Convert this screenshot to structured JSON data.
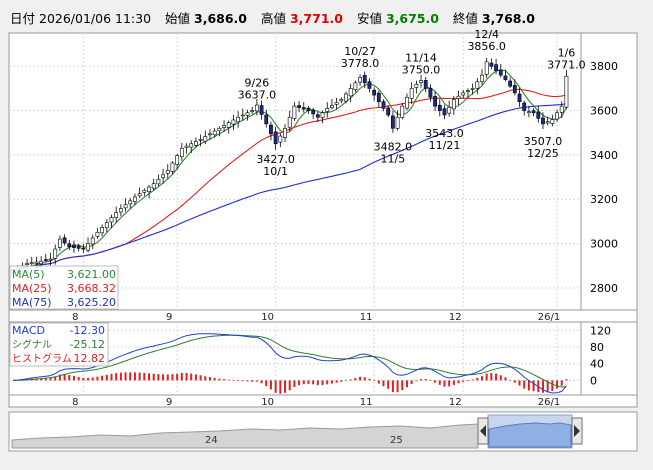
{
  "header": {
    "date_label": "日付",
    "date_value": "2026/01/06 11:30",
    "open_label": "始値",
    "open_value": "3,686.0",
    "high_label": "高値",
    "high_value": "3,771.0",
    "low_label": "安値",
    "low_value": "3,675.0",
    "close_label": "終値",
    "close_value": "3,768.0"
  },
  "colors": {
    "up_candle": "#ffffff",
    "down_candle": "#1c2a8c",
    "ma5": "#2e8b2e",
    "ma25": "#e02020",
    "ma75": "#2030c8",
    "macd": "#2040d0",
    "signal": "#2e7d2e",
    "histogram": "#e02020",
    "high_text": "#e00000",
    "low_text": "#008000"
  },
  "legend": [
    {
      "label": "MA(5)",
      "value": "3,621.00"
    },
    {
      "label": "MA(25)",
      "value": "3,668.32"
    },
    {
      "label": "MA(75)",
      "value": "3,625.20"
    }
  ],
  "macd_legend": [
    {
      "label": "MACD",
      "value": "-12.30"
    },
    {
      "label": "シグナル",
      "value": "-25.12"
    },
    {
      "label": "ヒストグラム",
      "value": "12.82"
    }
  ],
  "month_labels": [
    "8",
    "9",
    "10",
    "11",
    "12",
    "26/1"
  ],
  "navigator_labels": [
    "24",
    "25"
  ],
  "chart_data": [
    {
      "type": "candlestick",
      "title": "",
      "ylim": [
        2700,
        3950
      ],
      "yticks": [
        2800,
        3000,
        3200,
        3400,
        3600,
        3800
      ],
      "months": [
        {
          "label": "8",
          "start_index": 15
        },
        {
          "label": "9",
          "start_index": 35
        },
        {
          "label": "10",
          "start_index": 56
        },
        {
          "label": "11",
          "start_index": 77
        },
        {
          "label": "12",
          "start_index": 96
        },
        {
          "label": "26/1",
          "start_index": 116
        }
      ],
      "annotations": [
        {
          "index": 52,
          "date": "9/26",
          "value": "3637.0",
          "pos": "above"
        },
        {
          "index": 56,
          "date": "10/1",
          "value": "3427.0",
          "pos": "below"
        },
        {
          "index": 74,
          "date": "10/27",
          "value": "3778.0",
          "pos": "above"
        },
        {
          "index": 81,
          "date": "11/5",
          "value": "3482.0",
          "pos": "below"
        },
        {
          "index": 87,
          "date": "11/14",
          "value": "3750.0",
          "pos": "above"
        },
        {
          "index": 92,
          "date": "11/21",
          "value": "3543.0",
          "pos": "below"
        },
        {
          "index": 101,
          "date": "12/4",
          "value": "3856.0",
          "pos": "above"
        },
        {
          "index": 113,
          "date": "12/25",
          "value": "3507.0",
          "pos": "below"
        },
        {
          "index": 118,
          "date": "1/6",
          "value": "3771.0",
          "pos": "above"
        }
      ],
      "anchors": [
        [
          0,
          2880
        ],
        [
          3,
          2910
        ],
        [
          6,
          2920
        ],
        [
          8,
          2930
        ],
        [
          10,
          3020
        ],
        [
          12,
          2985
        ],
        [
          15,
          2975
        ],
        [
          18,
          3050
        ],
        [
          22,
          3140
        ],
        [
          26,
          3210
        ],
        [
          30,
          3270
        ],
        [
          33,
          3330
        ],
        [
          36,
          3430
        ],
        [
          40,
          3470
        ],
        [
          44,
          3520
        ],
        [
          48,
          3570
        ],
        [
          51,
          3600
        ],
        [
          52,
          3625
        ],
        [
          54,
          3540
        ],
        [
          56,
          3450
        ],
        [
          58,
          3520
        ],
        [
          60,
          3620
        ],
        [
          63,
          3600
        ],
        [
          65,
          3570
        ],
        [
          67,
          3610
        ],
        [
          70,
          3650
        ],
        [
          72,
          3700
        ],
        [
          74,
          3750
        ],
        [
          76,
          3700
        ],
        [
          78,
          3640
        ],
        [
          80,
          3580
        ],
        [
          81,
          3520
        ],
        [
          83,
          3620
        ],
        [
          85,
          3700
        ],
        [
          87,
          3735
        ],
        [
          88,
          3700
        ],
        [
          90,
          3620
        ],
        [
          92,
          3580
        ],
        [
          94,
          3650
        ],
        [
          96,
          3680
        ],
        [
          98,
          3700
        ],
        [
          100,
          3760
        ],
        [
          101,
          3820
        ],
        [
          103,
          3780
        ],
        [
          105,
          3740
        ],
        [
          107,
          3680
        ],
        [
          109,
          3600
        ],
        [
          111,
          3590
        ],
        [
          113,
          3540
        ],
        [
          115,
          3560
        ],
        [
          117,
          3620
        ],
        [
          118,
          3755
        ]
      ],
      "series_names": [
        "MA(5)",
        "MA(25)",
        "MA(75)"
      ]
    },
    {
      "type": "bar+line",
      "title": "",
      "ylim": [
        -35,
        140
      ],
      "yticks": [
        0,
        40,
        80,
        120
      ],
      "series_names": [
        "MACD",
        "シグナル",
        "ヒストグラム"
      ]
    }
  ]
}
